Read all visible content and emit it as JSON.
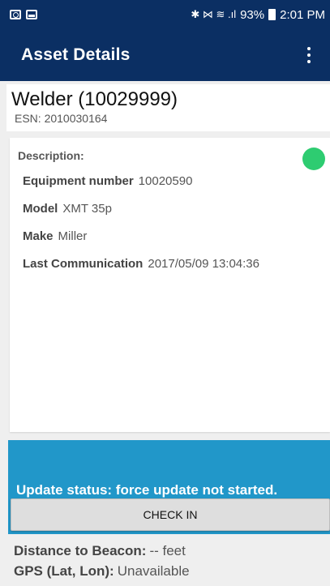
{
  "status_bar": {
    "signal_text": "✱ ⋈ ≋ .ıl",
    "battery": "93%",
    "time": "2:01 PM"
  },
  "app_bar": {
    "title": "Asset Details"
  },
  "asset": {
    "name": "Welder (10029999)",
    "esn": "ESN: 2010030164"
  },
  "details": {
    "description_label": "Description:",
    "status_color": "#2ecc71",
    "rows": [
      {
        "label": "Equipment number",
        "value": "10020590"
      },
      {
        "label": "Model",
        "value": "XMT 35p"
      },
      {
        "label": "Make",
        "value": "Miller"
      },
      {
        "label": "Last Communication",
        "value": "2017/05/09 13:04:36"
      }
    ]
  },
  "update": {
    "status_text": "Update status: force update not started.",
    "checkin_label": "CHECK IN"
  },
  "bottom": {
    "distance_label": "Distance to Beacon:",
    "distance_value": "-- feet",
    "gps_label": "GPS (Lat, Lon):",
    "gps_value": "Unavailable"
  },
  "colors": {
    "app_bar": "#0b2f63",
    "update_panel": "#2197c9",
    "status_dot": "#2ecc71"
  }
}
